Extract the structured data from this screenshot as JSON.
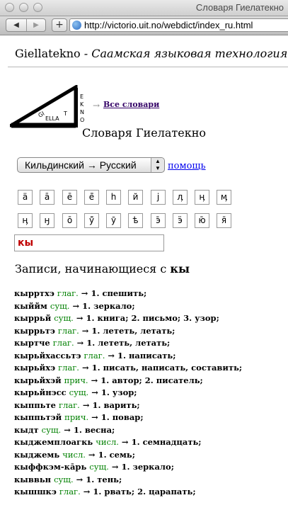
{
  "window": {
    "title": "Словаря Гиелатекно"
  },
  "toolbar": {
    "back": "◀",
    "forward": "▶",
    "add": "+",
    "url": "http://victorio.uit.no/webdict/index_ru.html"
  },
  "header": {
    "brand": "Giellatekno",
    "tagline": " - Саамская языковая технология -"
  },
  "logo": {
    "text": "GIELLATEKNO"
  },
  "all_dicts": {
    "arrow": "→",
    "label": "Все словари"
  },
  "page_title": "Словаря Гиелатекно",
  "language_select": {
    "selected": "Кильдинский → Русский",
    "arrows": "▲▼"
  },
  "help_link": "помощь",
  "keyboard_rows": [
    [
      "ä",
      "ā",
      "ē",
      "ē̄",
      "һ",
      "й",
      "ј",
      "ӆ",
      "ӊ",
      "ӎ"
    ],
    [
      "ӊ",
      "ӈ",
      "ō",
      "ӯ̄",
      "ӯ",
      "ѣ",
      "э̄",
      "ӭ",
      "ю̄",
      "я̄"
    ]
  ],
  "search": {
    "value": "кы"
  },
  "results": {
    "prefix": "Записи, начинающиеся с",
    "term": "кы"
  },
  "entries": [
    {
      "word": "кырртхэ",
      "pos": "глаг.",
      "meaning": " → 1. спешить;"
    },
    {
      "word": "кыййм",
      "pos": "сущ.",
      "meaning": " → 1. зеркало;"
    },
    {
      "word": "кыррьй",
      "pos": "сущ.",
      "meaning": " → 1. книга; 2. письмо; 3. узор;"
    },
    {
      "word": "кыррьтэ",
      "pos": "глаг.",
      "meaning": " → 1. лететь, летать;"
    },
    {
      "word": "кыртче",
      "pos": "глаг.",
      "meaning": " → 1. лететь, летать;"
    },
    {
      "word": "кырьйхассьтэ",
      "pos": "глаг.",
      "meaning": " → 1. написать;"
    },
    {
      "word": "кырьйхэ",
      "pos": "глаг.",
      "meaning": " → 1. писать, написать, составить;"
    },
    {
      "word": "кырьйхэй",
      "pos": "прич.",
      "meaning": " → 1. автор; 2. писатель;"
    },
    {
      "word": "кырьйнэсс",
      "pos": "сущ.",
      "meaning": " → 1. узор;"
    },
    {
      "word": "кыппьте",
      "pos": "глаг.",
      "meaning": " → 1. варить;"
    },
    {
      "word": "кыппьтэй",
      "pos": "прич.",
      "meaning": " → 1. повар;"
    },
    {
      "word": "кыдт",
      "pos": "сущ.",
      "meaning": " → 1. весна;"
    },
    {
      "word": "кыджемплоагкь",
      "pos": "числ.",
      "meaning": " → 1. семнадцать;"
    },
    {
      "word": "кыджемь",
      "pos": "числ.",
      "meaning": " → 1. семь;"
    },
    {
      "word": "кыффкэм-ка̄рь",
      "pos": "сущ.",
      "meaning": " → 1. зеркало;"
    },
    {
      "word": "кыввьн",
      "pos": "сущ.",
      "meaning": " → 1. тень;"
    },
    {
      "word": "кышшкэ",
      "pos": "глаг.",
      "meaning": " → 1. рвать; 2. царапать;"
    }
  ]
}
